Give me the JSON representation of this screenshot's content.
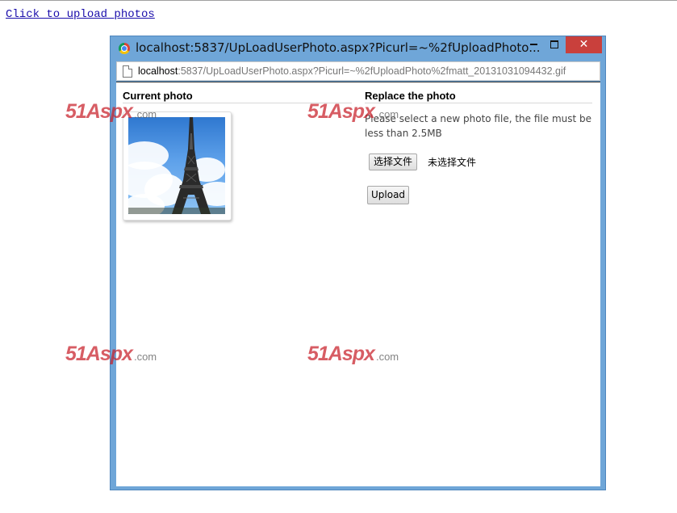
{
  "page": {
    "link_text": "Click to upload photos"
  },
  "dialog": {
    "title": "localhost:5837/UpLoadUserPhoto.aspx?Picurl=~%2fUploadPhoto...",
    "controls": {
      "minimize_icon": "minimize-icon",
      "maximize_icon": "maximize-icon",
      "close_glyph": "✕"
    },
    "address": {
      "host": "localhost",
      "path": ":5837/UpLoadUserPhoto.aspx?Picurl=~%2fUploadPhoto%2fmatt_20131031094432.gif"
    },
    "current": {
      "heading": "Current photo"
    },
    "replace": {
      "heading": "Replace the photo",
      "instruction": "Please select a new photo file, the file must be less than 2.5MB",
      "file_button": "选择文件",
      "file_status": "未选择文件",
      "upload_button": "Upload"
    }
  },
  "watermark": {
    "main": "51Aspx",
    "suffix": ".com"
  },
  "colors": {
    "frame_blue": "#6fa6d8",
    "close_red": "#c9403c",
    "link_blue": "#1a0dab"
  }
}
